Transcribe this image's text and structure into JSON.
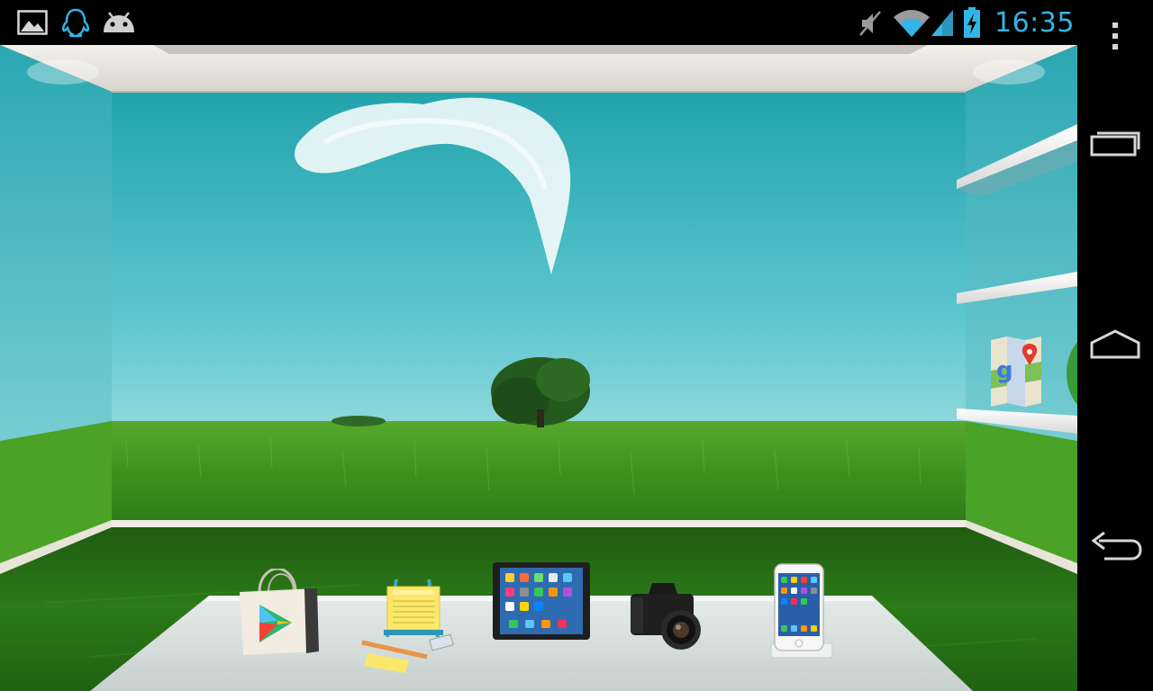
{
  "status_bar": {
    "time": "16:35",
    "notification_icons": [
      "gallery-icon",
      "qq-penguin-icon",
      "android-icon"
    ],
    "system_icons": [
      "mute-icon",
      "wifi-icon",
      "signal-icon",
      "battery-charging-icon"
    ],
    "accent_color": "#33b5e5"
  },
  "home_screen": {
    "theme": "3d-room-launcher",
    "shelf_apps": [
      "google-maps-icon",
      "browser-icon"
    ],
    "dock_apps": [
      "play-store-icon",
      "notes-easel-icon",
      "tablet-icon",
      "camera-icon",
      "phone-icon"
    ]
  },
  "nav_bar": {
    "buttons": [
      "menu-icon",
      "recent-apps-icon",
      "home-icon",
      "back-icon"
    ]
  }
}
